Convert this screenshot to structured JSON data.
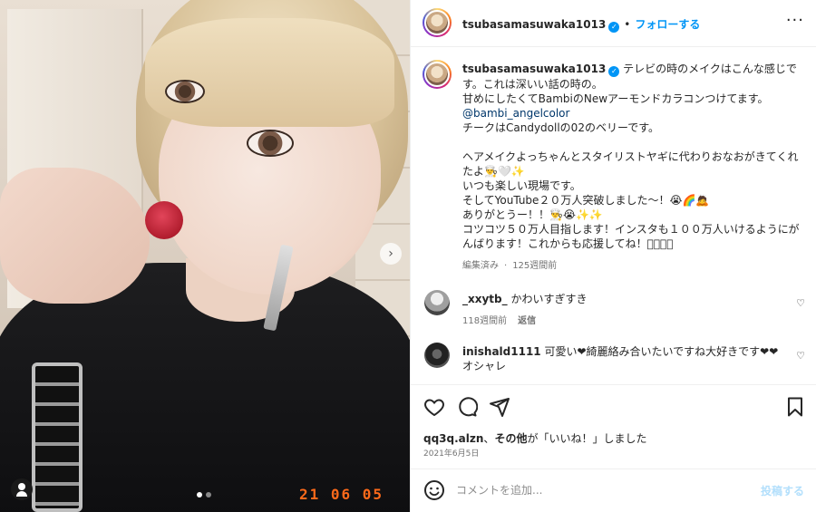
{
  "photo": {
    "timestamp": "21 06 05",
    "slide_count": 2,
    "active_slide": 1,
    "next_icon": "chevron-right-icon",
    "tag_icon": "user-tag-icon"
  },
  "header": {
    "username": "tsubasamasuwaka1013",
    "separator": "•",
    "follow_label": "フォローする",
    "more_label": "···"
  },
  "caption": {
    "username": "tsubasamasuwaka1013",
    "line1": "テレビの時のメイクはこんな感じです。これは深いい話の時の。",
    "line2": "甘めにしたくてBambiのNewアーモンドカラコンつけてます。",
    "mention": "@bambi_angelcolor",
    "line3": "チークはCandydollの02のベリーです。",
    "line4": "ヘアメイクよっちゃんとスタイリストヤギに代わりおなおがきてくれたよ👨‍🍳🤍✨",
    "line5": "いつも楽しい現場です。",
    "line6": "そしてYouTube２０万人突破しました〜！😭🌈🙇",
    "line7": "ありがとうー！！👨‍🍳😭✨✨",
    "line8": "コツコツ５０万人目指します！インスタも１００万人いけるようにがんばります！これからも応援してね！􏿿􏿿􏿿􏿿",
    "edited": "編集済み",
    "time": "125週間前"
  },
  "comments": [
    {
      "username": "_xxytb_",
      "text": "かわいすぎすき",
      "time": "118週間前",
      "reply_label": "返信"
    },
    {
      "username": "inishald1111",
      "text": "可愛い❤綺麗絡み合いたいですね大好きです❤❤オシャレ"
    }
  ],
  "likes": {
    "user": "qq3q.alzn",
    "sep": "、",
    "others": "その他",
    "suffix": "が「いいね！」しました"
  },
  "date": "2021年6月5日",
  "composer": {
    "placeholder": "コメントを追加...",
    "post_label": "投稿する"
  },
  "colors": {
    "accent": "#0095f6",
    "mention": "#00376b",
    "muted": "#737373",
    "post_disabled": "#b2dffc",
    "timestamp_stamp": "#ff6a1a"
  }
}
